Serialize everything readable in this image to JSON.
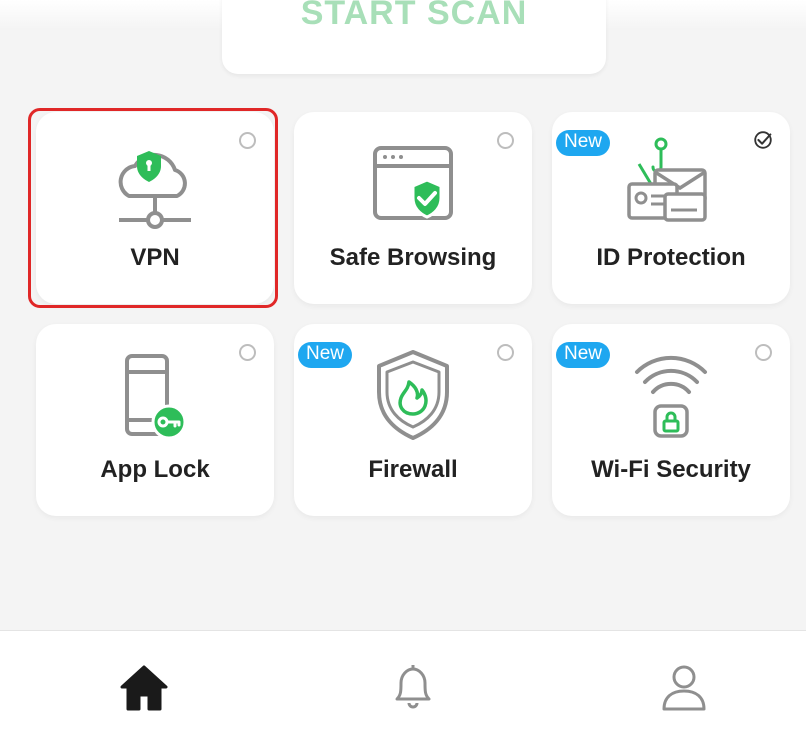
{
  "scan_button": {
    "label": "START SCAN"
  },
  "features": [
    {
      "label": "VPN",
      "badge": "",
      "icon": "cloud-shield-icon",
      "checked": false,
      "selected": true
    },
    {
      "label": "Safe Browsing",
      "badge": "",
      "icon": "browser-shield-icon",
      "checked": false,
      "selected": false
    },
    {
      "label": "ID Protection",
      "badge": "New",
      "icon": "id-cards-icon",
      "checked": true,
      "selected": false
    },
    {
      "label": "App Lock",
      "badge": "",
      "icon": "phone-key-icon",
      "checked": false,
      "selected": false
    },
    {
      "label": "Firewall",
      "badge": "New",
      "icon": "shield-flame-icon",
      "checked": false,
      "selected": false
    },
    {
      "label": "Wi-Fi Security",
      "badge": "New",
      "icon": "wifi-lock-icon",
      "checked": false,
      "selected": false
    }
  ],
  "bottom_nav": [
    {
      "name": "home",
      "icon": "home-icon",
      "active": true
    },
    {
      "name": "notifications",
      "icon": "bell-icon",
      "active": false
    },
    {
      "name": "profile",
      "icon": "user-icon",
      "active": false
    }
  ],
  "colors": {
    "accent_green": "#2ebd59",
    "badge_blue": "#1ea7f0",
    "selection_red": "#e02727",
    "icon_gray": "#8f8f8f"
  }
}
